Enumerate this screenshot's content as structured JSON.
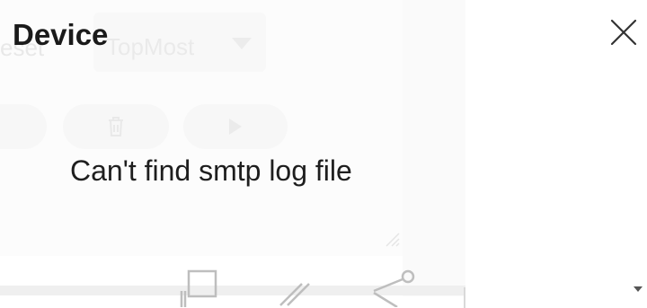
{
  "dialog": {
    "title": "Device",
    "message": "Can't find smtp log file"
  },
  "background": {
    "reset_label": "eset",
    "select_value": "TopMost"
  },
  "icons": {
    "close": "close-icon",
    "delete": "trash-icon",
    "play": "play-icon",
    "window": "window-icon",
    "edit": "pencil-icon",
    "share": "share-icon",
    "scroll_down": "chevron-down-icon"
  },
  "colors": {
    "title_text": "#1a1a1a",
    "message_text": "#1e1e1e",
    "background": "#ffffff"
  }
}
